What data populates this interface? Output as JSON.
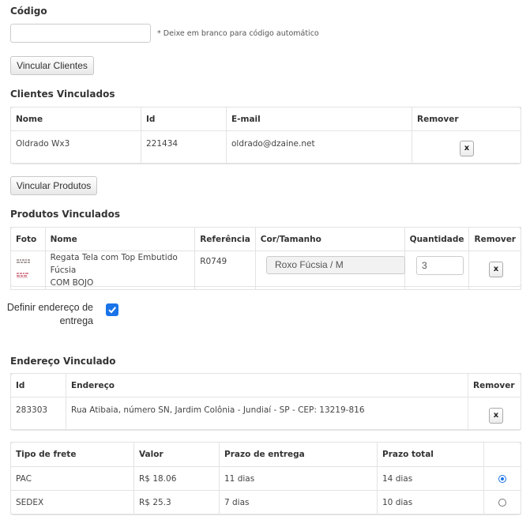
{
  "codigo": {
    "heading": "Código",
    "input_value": "",
    "hint": "* Deixe em branco para código automático"
  },
  "vincular_clientes_label": "Vincular Clientes",
  "clientes": {
    "heading": "Clientes Vinculados",
    "columns": [
      "Nome",
      "Id",
      "E-mail",
      "Remover"
    ],
    "rows": [
      {
        "nome": "Oldrado Wx3",
        "id": "221434",
        "email": "oldrado@dzaine.net",
        "remove": "x"
      }
    ]
  },
  "vincular_produtos_label": "Vincular Produtos",
  "produtos": {
    "heading": "Produtos Vinculados",
    "columns": [
      "Foto",
      "Nome",
      "Referência",
      "Cor/Tamanho",
      "Quantidade",
      "Remover"
    ],
    "rows": [
      {
        "nome_line1": "Regata Tela com Top Embutido Fúcsia",
        "nome_line2": "COM BOJO",
        "referencia": "R0749",
        "cor_tamanho": "Roxo Fúcsia / M",
        "quantidade": "3",
        "remove": "x"
      }
    ]
  },
  "definir_endereco": {
    "line1": "Definir endereço de",
    "line2": "entrega",
    "checked": true
  },
  "endereco": {
    "heading": "Endereço Vinculado",
    "columns": [
      "Id",
      "Endereço",
      "Remover"
    ],
    "rows": [
      {
        "id": "283303",
        "endereco": "Rua Atibaia, número SN, Jardim Colônia - Jundiaí - SP - CEP: 13219-816",
        "remove": "x"
      }
    ]
  },
  "frete": {
    "columns": [
      "Tipo de frete",
      "Valor",
      "Prazo de entrega",
      "Prazo total"
    ],
    "rows": [
      {
        "tipo": "PAC",
        "valor": "R$ 18.06",
        "prazo": "11 dias",
        "total": "14 dias",
        "selected": true
      },
      {
        "tipo": "SEDEX",
        "valor": "R$ 25.3",
        "prazo": "7 dias",
        "total": "10 dias",
        "selected": false
      }
    ]
  },
  "colors": {
    "accent": "#1a73e8",
    "border": "#e3e3e3"
  }
}
